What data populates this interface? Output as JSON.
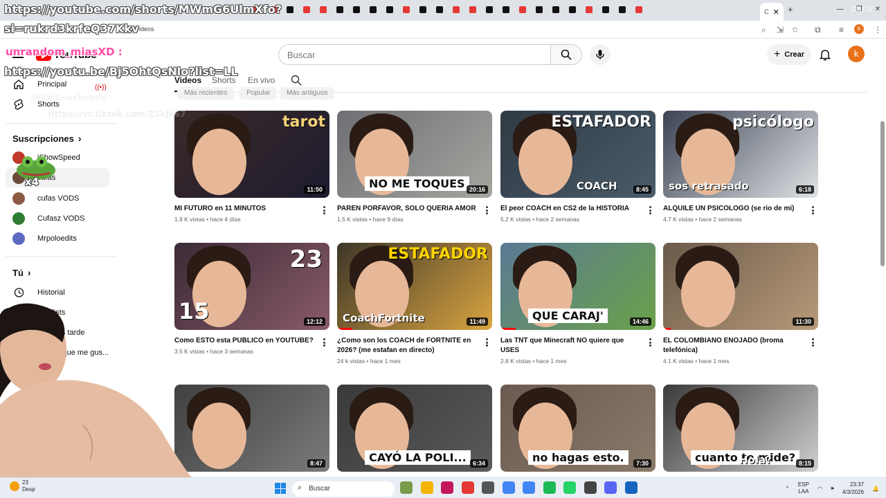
{
  "browser": {
    "url": "asz/videos",
    "system_stats": [
      "CPU 27 %"
    ]
  },
  "overlay": {
    "line1": "https://youtube.com/shorts/MWmG6UlmXfo?",
    "line2": "si=rukrd3krfeQ37Kkv",
    "user": "unrandom_miasXD :",
    "line3": "https://youtu.be/Bj5OhtQsNlo?list=LL",
    "faint1": "skibidinachogng :",
    "faint2": "https://vt.tiktok.com/ZSkJk67",
    "badge": "x4"
  },
  "header": {
    "logo": "YouTube",
    "search_placeholder": "Buscar",
    "create_label": "Crear",
    "avatar_letter": "k"
  },
  "sidebar": {
    "home": "Principal",
    "shorts": "Shorts",
    "subs_heading": "Suscripciones",
    "subs": [
      {
        "label": "iShowSpeed"
      },
      {
        "label": "cufas"
      },
      {
        "label": "cufas VODS"
      },
      {
        "label": "Cufasz VODS"
      },
      {
        "label": "Mrpoloedits"
      }
    ],
    "you_heading": "Tú",
    "history": "Historial",
    "playlists": "Playlists",
    "watch_later": "Ver más tarde",
    "liked": "Videos que me gus..."
  },
  "channel_tabs": {
    "videos": "Videos",
    "shorts": "Shorts",
    "live": "En vivo"
  },
  "chips": [
    "Más recientes",
    "Popular",
    "Más antiguos"
  ],
  "videos": [
    {
      "title": "MI FUTURO en 11 MINUTOS",
      "meta": "1.9 K vistas • hace 4 días",
      "duration": "11:50",
      "thumb_text": "tarot",
      "progress": 0.0
    },
    {
      "title": "PAREN PORFAVOR, SOLO QUERIA AMOR",
      "meta": "1.5 K vistas • hace 9 días",
      "duration": "20:16",
      "thumb_text": "NO ME TOQUES",
      "progress": 0.0
    },
    {
      "title": "El peor COACH en CS2 de la HISTORIA",
      "meta": "5.2 K vistas • hace 2 semanas",
      "duration": "8:45",
      "thumb_text": "ESTAFADOR",
      "thumb_text2": "COACH",
      "progress": 0.0
    },
    {
      "title": "ALQUILE UN PSICOLOGO (se rio de mi)",
      "meta": "4.7 K vistas • hace 2 semanas",
      "duration": "6:18",
      "thumb_text": "psicólogo",
      "thumb_text2": "sos retrasado",
      "progress": 0.0
    },
    {
      "title": "Como ESTO esta PUBLICO en YOUTUBE?",
      "meta": "3.5 K vistas • hace 3 semanas",
      "duration": "12:12",
      "thumb_text": "23",
      "thumb_text2": "15",
      "progress": 0.0
    },
    {
      "title": "¿Como son los COACH de FORTNITE en 2026? (me estafan en directo)",
      "meta": "24 k vistas • hace 1 mes",
      "duration": "11:49",
      "thumb_text": "ESTAFADOR",
      "thumb_text2": "CoachFortnite",
      "progress": 0.1
    },
    {
      "title": "Las TNT que Minecraft NO quiere que USES",
      "meta": "2.8 K vistas • hace 1 mes",
      "duration": "14:46",
      "thumb_text": "QUE CARAJ'",
      "progress": 0.1
    },
    {
      "title": "EL COLOMBIANO ENOJADO (broma telefónica)",
      "meta": "4.1 K vistas • hace 1 mes",
      "duration": "11:30",
      "thumb_text": "",
      "progress": 0.05
    },
    {
      "title": "",
      "meta": "",
      "duration": "8:47",
      "thumb_text": "",
      "progress": 0.0
    },
    {
      "title": "",
      "meta": "",
      "duration": "6:34",
      "thumb_text": "CAYÓ LA POLI...",
      "progress": 0.0
    },
    {
      "title": "",
      "meta": "",
      "duration": "7:30",
      "thumb_text": "no hagas esto.",
      "progress": 0.0
    },
    {
      "title": "",
      "meta": "",
      "duration": "8:15",
      "thumb_text": "cuanto te mide?",
      "thumb_text2": "Hola?",
      "progress": 0.0
    }
  ],
  "taskbar": {
    "search": "Buscar",
    "lang": "ESP",
    "lang2": "LAA",
    "time": "23:37",
    "date": "4/3/2026",
    "weather": "23",
    "weather_label": "Desp"
  }
}
